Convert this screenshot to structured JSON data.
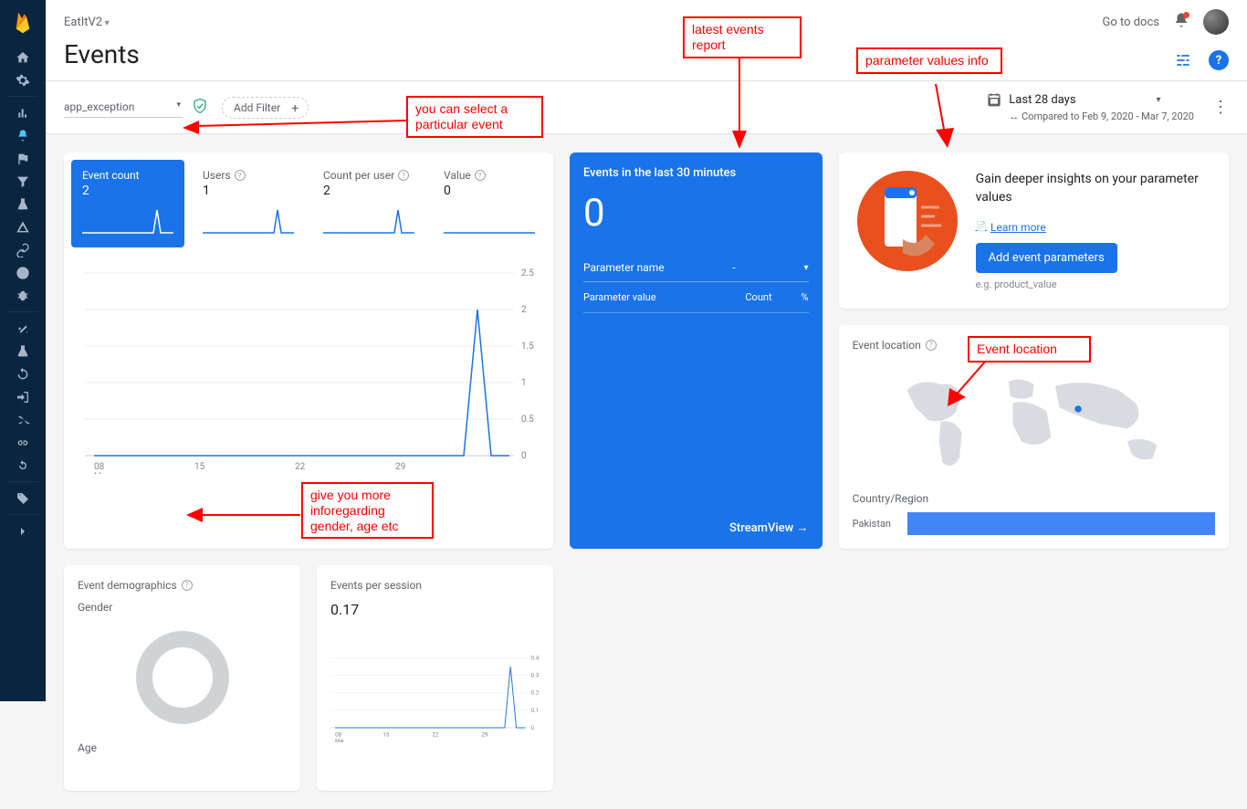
{
  "project_name": "EatItV2",
  "page_title": "Events",
  "go_to_docs": "Go to docs",
  "event_selected": "app_exception",
  "add_filter": "Add Filter",
  "date_range_label": "Last 28 days",
  "date_compare": "Compared to Feb 9, 2020 - Mar 7, 2020",
  "metrics": [
    {
      "label": "Event count",
      "value": "2"
    },
    {
      "label": "Users",
      "value": "1"
    },
    {
      "label": "Count per user",
      "value": "2"
    },
    {
      "label": "Value",
      "value": "0"
    }
  ],
  "blue_card": {
    "title": "Events in the last 30 minutes",
    "value": "0",
    "param_name_label": "Parameter name",
    "param_value_label": "Parameter value",
    "count_label": "Count",
    "percent_label": "%",
    "stream_view": "StreamView"
  },
  "insights": {
    "title": "Gain deeper insights on your parameter values",
    "learn_more": "Learn more",
    "button": "Add event parameters",
    "example": "e.g. product_value"
  },
  "location": {
    "label": "Event location",
    "country_header": "Country/Region",
    "country": "Pakistan"
  },
  "demographics": {
    "label": "Event demographics",
    "gender": "Gender",
    "age": "Age"
  },
  "session": {
    "label": "Events per session",
    "value": "0.17"
  },
  "annotations": {
    "select_event": "you can select a particular event",
    "latest_events": "latest events report",
    "param_info": "parameter values info",
    "event_location": "Event location",
    "demographics": "give you more inforegarding gender, age etc"
  },
  "chart_data": {
    "main_chart": {
      "type": "line",
      "x_labels": [
        "08",
        "15",
        "22",
        "29"
      ],
      "x_axis_sub": "Mar",
      "y_ticks": [
        0,
        0.5,
        1,
        1.5,
        2,
        2.5
      ],
      "series": [
        {
          "name": "Event count",
          "values_by_date": {
            "08": 0,
            "15": 0,
            "22": 0,
            "29": 0,
            "peak_near_end": 2
          }
        }
      ]
    },
    "sparklines": {
      "event_count": [
        0,
        0,
        0,
        0,
        0,
        0,
        0,
        0,
        2,
        0
      ],
      "users": [
        0,
        0,
        0,
        0,
        0,
        0,
        0,
        0,
        1,
        0
      ],
      "count_per_user": [
        0,
        0,
        0,
        0,
        0,
        0,
        0,
        0,
        2,
        0
      ],
      "value": [
        0,
        0,
        0,
        0,
        0,
        0,
        0,
        0,
        0,
        0
      ]
    },
    "session_chart": {
      "type": "line",
      "x_labels": [
        "08",
        "15",
        "22",
        "29"
      ],
      "x_axis_sub": "Mar",
      "y_ticks": [
        0,
        0.1,
        0.2,
        0.3,
        0.4
      ],
      "peak_value": 0.35
    }
  }
}
